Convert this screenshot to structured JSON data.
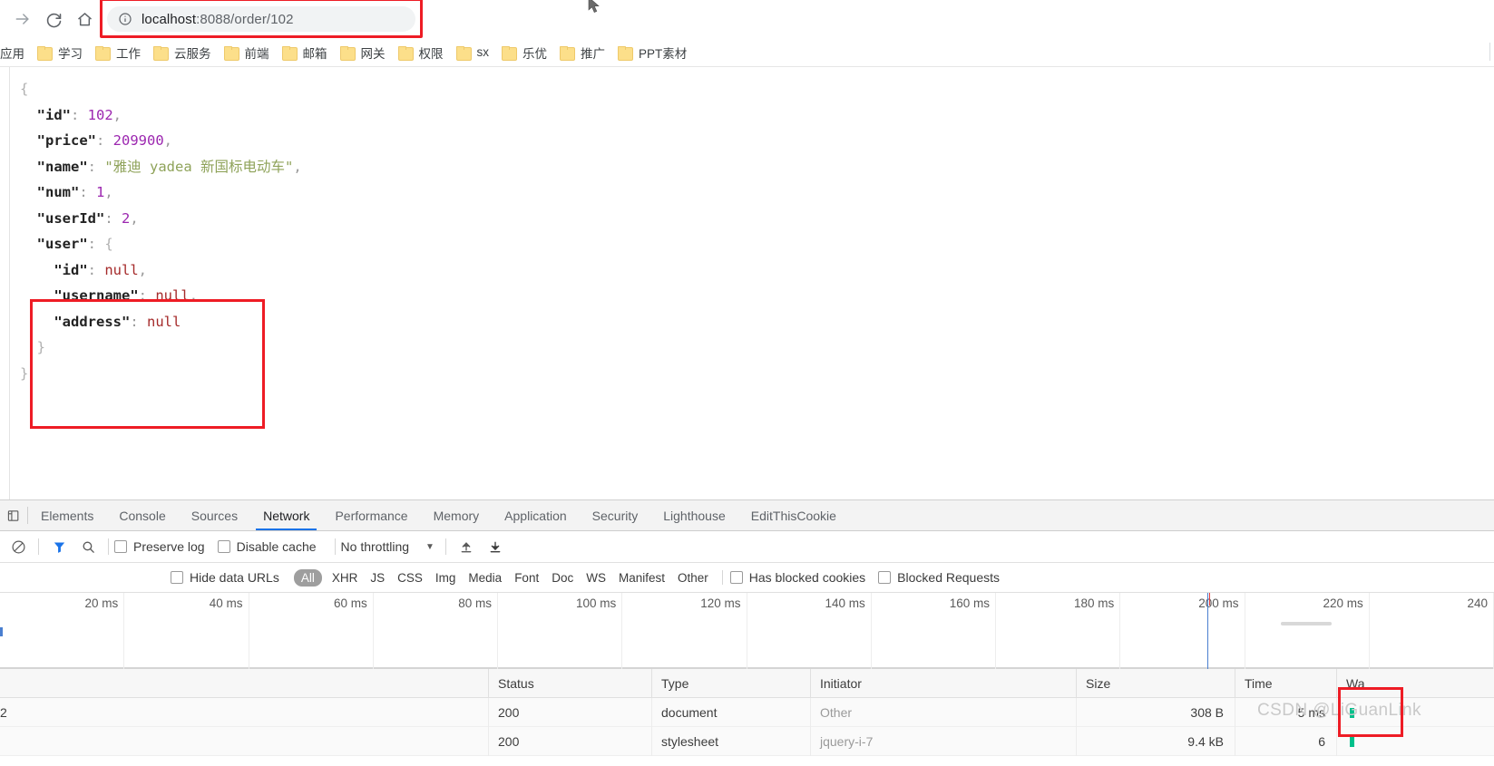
{
  "browser": {
    "nav": {
      "forward_icon": "arrow-right-icon",
      "reload_icon": "reload-icon",
      "home_icon": "home-icon"
    },
    "omnibox": {
      "info_icon": "info-circle-icon",
      "url_host": "localhost",
      "url_path": ":8088/order/102",
      "full_url": "localhost:8088/order/102"
    },
    "bookmarks": {
      "apps_label": "应用",
      "items": [
        {
          "label": "学习",
          "icon": "folder-icon"
        },
        {
          "label": "工作",
          "icon": "folder-icon"
        },
        {
          "label": "云服务",
          "icon": "folder-icon"
        },
        {
          "label": "前端",
          "icon": "folder-icon"
        },
        {
          "label": "邮箱",
          "icon": "folder-icon"
        },
        {
          "label": "网关",
          "icon": "folder-icon"
        },
        {
          "label": "权限",
          "icon": "folder-icon"
        },
        {
          "label": "sx",
          "icon": "folder-icon"
        },
        {
          "label": "乐优",
          "icon": "folder-icon"
        },
        {
          "label": "推广",
          "icon": "folder-icon"
        },
        {
          "label": "PPT素材",
          "icon": "folder-icon"
        }
      ]
    }
  },
  "page": {
    "json_lines": [
      {
        "indent": 0,
        "parts": [
          {
            "t": "{",
            "c": "brace"
          }
        ]
      },
      {
        "indent": 1,
        "parts": [
          {
            "t": "\"id\"",
            "c": "k"
          },
          {
            "t": ": ",
            "c": "pun"
          },
          {
            "t": "102",
            "c": "num"
          },
          {
            "t": ",",
            "c": "pun"
          }
        ]
      },
      {
        "indent": 1,
        "parts": [
          {
            "t": "\"price\"",
            "c": "k"
          },
          {
            "t": ": ",
            "c": "pun"
          },
          {
            "t": "209900",
            "c": "num"
          },
          {
            "t": ",",
            "c": "pun"
          }
        ]
      },
      {
        "indent": 1,
        "parts": [
          {
            "t": "\"name\"",
            "c": "k"
          },
          {
            "t": ": ",
            "c": "pun"
          },
          {
            "t": "\"雅迪 yadea 新国标电动车\"",
            "c": "str"
          },
          {
            "t": ",",
            "c": "pun"
          }
        ]
      },
      {
        "indent": 1,
        "parts": [
          {
            "t": "\"num\"",
            "c": "k"
          },
          {
            "t": ": ",
            "c": "pun"
          },
          {
            "t": "1",
            "c": "num"
          },
          {
            "t": ",",
            "c": "pun"
          }
        ]
      },
      {
        "indent": 1,
        "parts": [
          {
            "t": "\"userId\"",
            "c": "k"
          },
          {
            "t": ": ",
            "c": "pun"
          },
          {
            "t": "2",
            "c": "num"
          },
          {
            "t": ",",
            "c": "pun"
          }
        ]
      },
      {
        "indent": 1,
        "parts": [
          {
            "t": "\"user\"",
            "c": "k"
          },
          {
            "t": ": ",
            "c": "pun"
          },
          {
            "t": "{",
            "c": "brace"
          }
        ]
      },
      {
        "indent": 2,
        "parts": [
          {
            "t": "\"id\"",
            "c": "k"
          },
          {
            "t": ": ",
            "c": "pun"
          },
          {
            "t": "null",
            "c": "nul"
          },
          {
            "t": ",",
            "c": "pun"
          }
        ]
      },
      {
        "indent": 2,
        "parts": [
          {
            "t": "\"username\"",
            "c": "k"
          },
          {
            "t": ": ",
            "c": "pun"
          },
          {
            "t": "null",
            "c": "nul"
          },
          {
            "t": ",",
            "c": "pun"
          }
        ]
      },
      {
        "indent": 2,
        "parts": [
          {
            "t": "\"address\"",
            "c": "k"
          },
          {
            "t": ": ",
            "c": "pun"
          },
          {
            "t": "null",
            "c": "nul"
          }
        ]
      },
      {
        "indent": 1,
        "parts": [
          {
            "t": "}",
            "c": "brace"
          }
        ]
      },
      {
        "indent": 0,
        "parts": [
          {
            "t": "}",
            "c": "brace"
          }
        ]
      }
    ]
  },
  "devtools": {
    "dock_icon": "dock-panel-icon",
    "tabs": [
      {
        "label": "Elements",
        "active": false
      },
      {
        "label": "Console",
        "active": false
      },
      {
        "label": "Sources",
        "active": false
      },
      {
        "label": "Network",
        "active": true
      },
      {
        "label": "Performance",
        "active": false
      },
      {
        "label": "Memory",
        "active": false
      },
      {
        "label": "Application",
        "active": false
      },
      {
        "label": "Security",
        "active": false
      },
      {
        "label": "Lighthouse",
        "active": false
      },
      {
        "label": "EditThisCookie",
        "active": false
      }
    ],
    "toolbar": {
      "clear_icon": "no-entry-clear-icon",
      "filter_icon": "funnel-filter-icon",
      "search_icon": "search-icon",
      "preserve_log_label": "Preserve log",
      "preserve_log_checked": false,
      "disable_cache_label": "Disable cache",
      "disable_cache_checked": false,
      "throttling_value": "No throttling",
      "throttling_caret": "chevron-down-icon",
      "import_icon": "import-har-icon",
      "export_icon": "export-har-icon"
    },
    "filters": {
      "hide_data_urls_label": "Hide data URLs",
      "hide_data_urls_checked": false,
      "all_pill": "All",
      "types": [
        "XHR",
        "JS",
        "CSS",
        "Img",
        "Media",
        "Font",
        "Doc",
        "WS",
        "Manifest",
        "Other"
      ],
      "has_blocked_cookies_label": "Has blocked cookies",
      "has_blocked_cookies_checked": false,
      "blocked_requests_label": "Blocked Requests",
      "blocked_requests_checked": false
    },
    "overview": {
      "ticks": [
        "20 ms",
        "40 ms",
        "60 ms",
        "80 ms",
        "100 ms",
        "120 ms",
        "140 ms",
        "160 ms",
        "180 ms",
        "200 ms",
        "220 ms",
        "240"
      ]
    },
    "requests": {
      "columns": [
        "",
        "Status",
        "Type",
        "Initiator",
        "Size",
        "Time",
        "Wa"
      ],
      "rows": [
        {
          "name": "2",
          "status": "200",
          "type": "document",
          "initiator": "Other",
          "size": "308 B",
          "time": "5 ms",
          "waterfall": "green-bar"
        },
        {
          "name": "",
          "status": "200",
          "type": "stylesheet",
          "initiator": "jquery-i-7",
          "size": "9.4 kB",
          "time": "6",
          "waterfall": "green-bar"
        }
      ]
    }
  },
  "watermark": {
    "text": "CSDN @LiGuanLink"
  },
  "annotations": {
    "highlight_color": "#ee1c25",
    "boxes": [
      "url-bar-highlight",
      "user-object-highlight",
      "time-cell-highlight"
    ]
  }
}
